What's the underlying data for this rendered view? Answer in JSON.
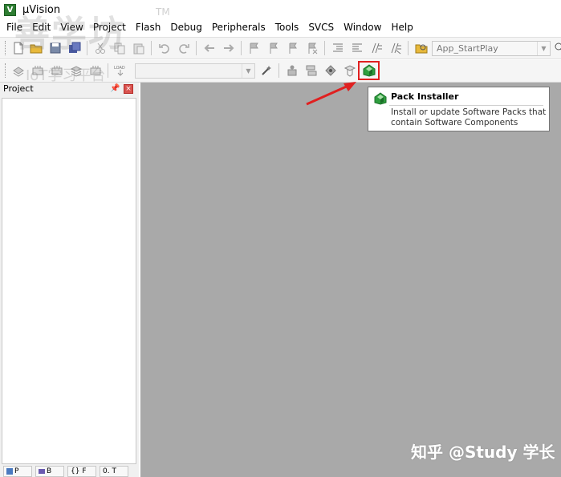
{
  "window": {
    "title": "µVision"
  },
  "menu": [
    "File",
    "Edit",
    "View",
    "Project",
    "Flash",
    "Debug",
    "Peripherals",
    "Tools",
    "SVCS",
    "Window",
    "Help"
  ],
  "toolbar": {
    "target_select": "App_StartPlay",
    "load_label": "LOAD"
  },
  "project_panel": {
    "title": "Project",
    "tabs": [
      "P",
      "B",
      "{} F",
      "0. T"
    ]
  },
  "tooltip": {
    "title": "Pack Installer",
    "description": "Install or update Software Packs that contain Software Components"
  },
  "watermarks": {
    "main": "善学坊",
    "tm": "TM",
    "sub": "IoT学习平台",
    "zhihu": "知乎 @Study 学长"
  },
  "colors": {
    "workspace": "#a9a9a9",
    "highlight": "#e02020",
    "pack_icon": "#2e9e3e"
  }
}
